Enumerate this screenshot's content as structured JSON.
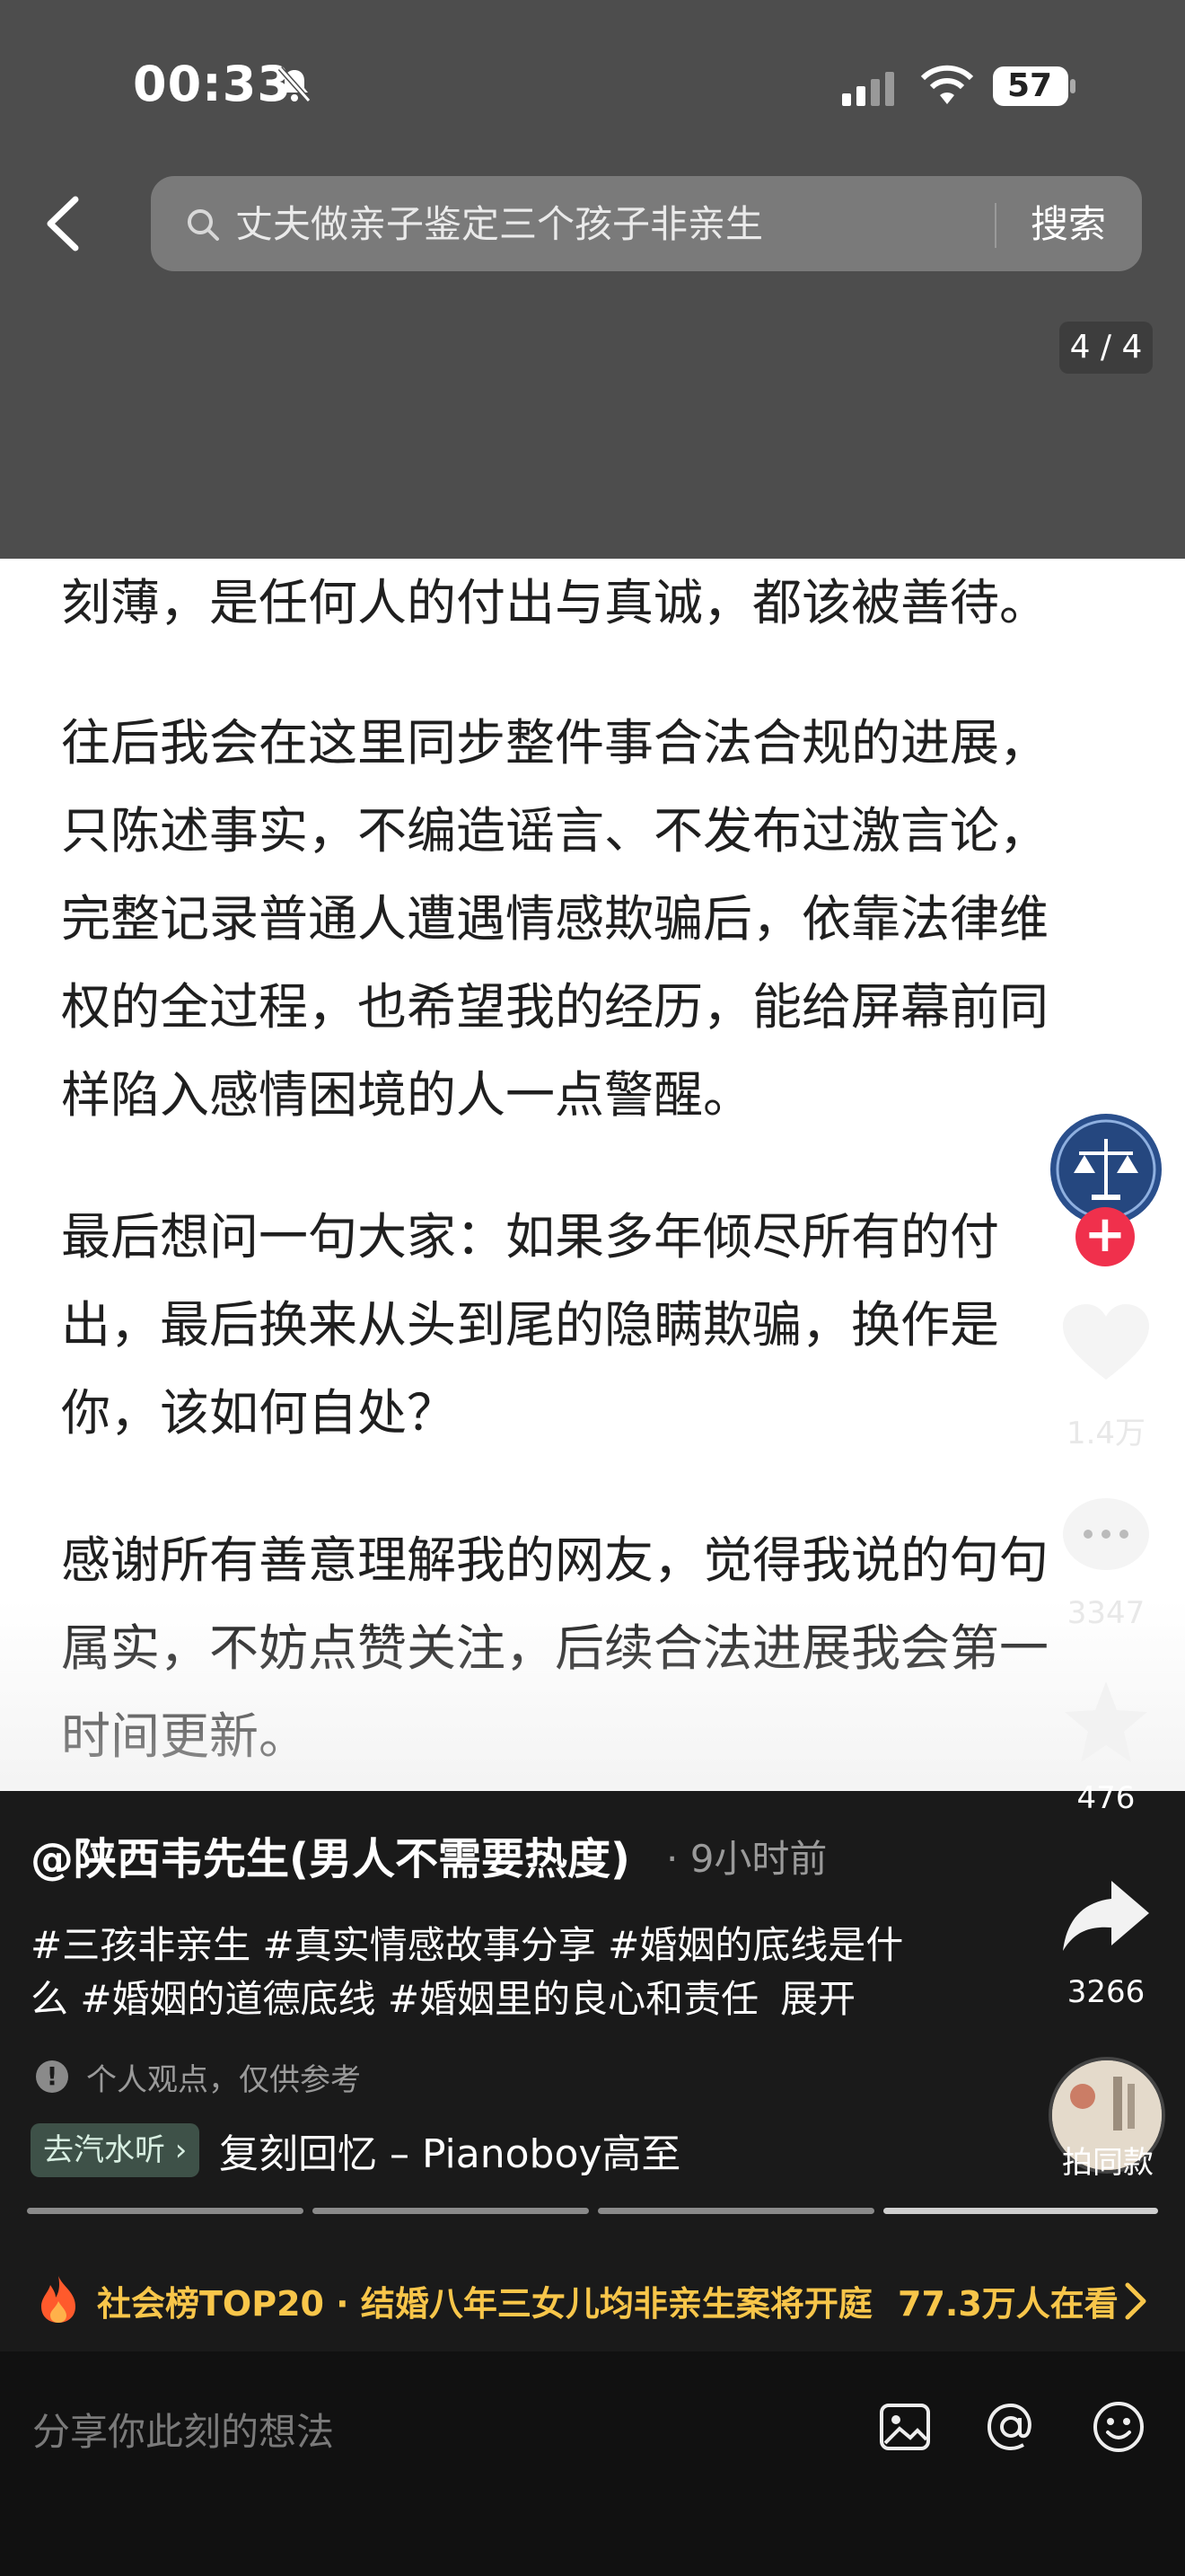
{
  "status_bar": {
    "time": "00:33",
    "battery": "57"
  },
  "search": {
    "query": "丈夫做亲子鉴定三个孩子非亲生",
    "button": "搜索"
  },
  "page_indicator": "4 / 4",
  "article": {
    "paragraphs": [
      [
        "刻薄，是任何人的付出与真诚，都该被善待。"
      ],
      [
        "往后我会在这里同步整件事合法合规的进展，",
        "只陈述事实，不编造谣言、不发布过激言论，",
        "完整记录普通人遭遇情感欺骗后，依靠法律维",
        "权的全过程，也希望我的经历，能给屏幕前同",
        "样陷入感情困境的人一点警醒。"
      ],
      [
        "最后想问一句大家：如果多年倾尽所有的付",
        "出，最后换来从头到尾的隐瞒欺骗，换作是",
        "你，该如何自处？"
      ],
      [
        "感谢所有善意理解我的网友，觉得我说的句句",
        "属实，不妨点赞关注，后续合法进展我会第一",
        "时间更新。"
      ]
    ]
  },
  "side_actions": {
    "likes": "1.4万",
    "comments": "3347",
    "favorites": "476",
    "shares": "3266"
  },
  "post": {
    "author": "@陕西韦先生(男人不需要热度)",
    "time": "· 9小时前",
    "tags_line1": "#三孩非亲生 #真实情感故事分享 #婚姻的底线是什",
    "tags_line2": "么 #婚姻的道德底线 #婚姻里的良心和责任",
    "expand": "展开",
    "disclaimer": "个人观点，仅供参考",
    "music_tag": "去汽水听 ›",
    "music_title": "复刻回忆 – Pianoboy高至",
    "same_style": "拍同款"
  },
  "hot": {
    "text": "社会榜TOP20 · 结婚八年三女儿均非亲生案将开庭",
    "count": "77.3万人在看"
  },
  "comment": {
    "placeholder": "分享你此刻的想法"
  },
  "colors": {
    "accent_red": "#f0304c",
    "hot_yellow": "#f8c64a"
  }
}
